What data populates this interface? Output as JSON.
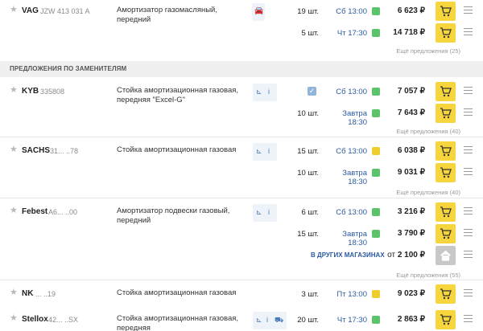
{
  "colors": {
    "accent_yellow": "#f6d63c",
    "green": "#5cc36a",
    "yellow": "#f0cd2c",
    "link_blue": "#2b5aa0"
  },
  "top": {
    "brand": "VAG",
    "article": "JZW 413 031 A",
    "description": "Амортизатор газомасляный, передний",
    "icons": [
      "car-icon"
    ],
    "offers": [
      {
        "qty": "19 шт.",
        "delivery": "Сб 13:00",
        "status": "green",
        "price": "6 623 ₽"
      },
      {
        "qty": "5 шт.",
        "delivery": "Чт 17:30",
        "status": "green",
        "price": "14 718 ₽"
      }
    ],
    "more_offers": "Ещё предложения (25)"
  },
  "section_title": "ПРЕДЛОЖЕНИЯ ПО ЗАМЕНИТЕЛЯМ",
  "items": [
    {
      "brand": "KYB",
      "article": "335808",
      "description": "Стойка амортизационная газовая, передняя \"Excel-G\"",
      "icons": [
        "scheme-icon",
        "info-icon"
      ],
      "offers": [
        {
          "qty": "",
          "delivery": "Сб 13:00",
          "status": "green",
          "price": "7 057 ₽"
        },
        {
          "qty": "10 шт.",
          "delivery": "Завтра 18:30",
          "status": "green",
          "price": "7 643 ₽"
        }
      ],
      "more_offers": "Ещё предложения (40)"
    },
    {
      "brand": "SACHS",
      "article": "31... ..78",
      "description": "Стойка амортизационная газовая",
      "icons": [
        "scheme-icon",
        "info-icon"
      ],
      "offers": [
        {
          "qty": "15 шт.",
          "delivery": "Сб 13:00",
          "status": "yellow",
          "price": "6 038 ₽"
        },
        {
          "qty": "10 шт.",
          "delivery": "Завтра 18:30",
          "status": "green",
          "price": "9 031 ₽"
        }
      ],
      "more_offers": "Ещё предложения (40)"
    },
    {
      "brand": "Febest",
      "article": "A6... ..00",
      "description": "Амортизатор подвески газовый, передний",
      "icons": [
        "scheme-icon",
        "info-icon"
      ],
      "offers": [
        {
          "qty": "6 шт.",
          "delivery": "Сб 13:00",
          "status": "green",
          "price": "3 216 ₽"
        },
        {
          "qty": "15 шт.",
          "delivery": "Завтра 18:30",
          "status": "green",
          "price": "3 790 ₽"
        }
      ],
      "other_stores": {
        "label": "В ДРУГИХ МАГАЗИНАХ",
        "price_prefix": "от",
        "price": "2 100 ₽"
      },
      "more_offers": "Ещё предложения (55)"
    },
    {
      "brand": "NK",
      "article": "...   ..19",
      "description": "Стойка амортизационная газовая",
      "offers": [
        {
          "qty": "3 шт.",
          "delivery": "Пт 13:00",
          "status": "yellow",
          "price": "9 023 ₽"
        }
      ]
    },
    {
      "brand": "Stellox",
      "article": "42... ..SX",
      "description": "Стойка амортизационная газовая, передняя",
      "icons": [
        "scheme-icon",
        "info-icon",
        "car-icon"
      ],
      "offers": [
        {
          "qty": "20 шт.",
          "delivery": "Чт 17:30",
          "status": "green",
          "price": "2 863 ₽"
        }
      ]
    }
  ]
}
